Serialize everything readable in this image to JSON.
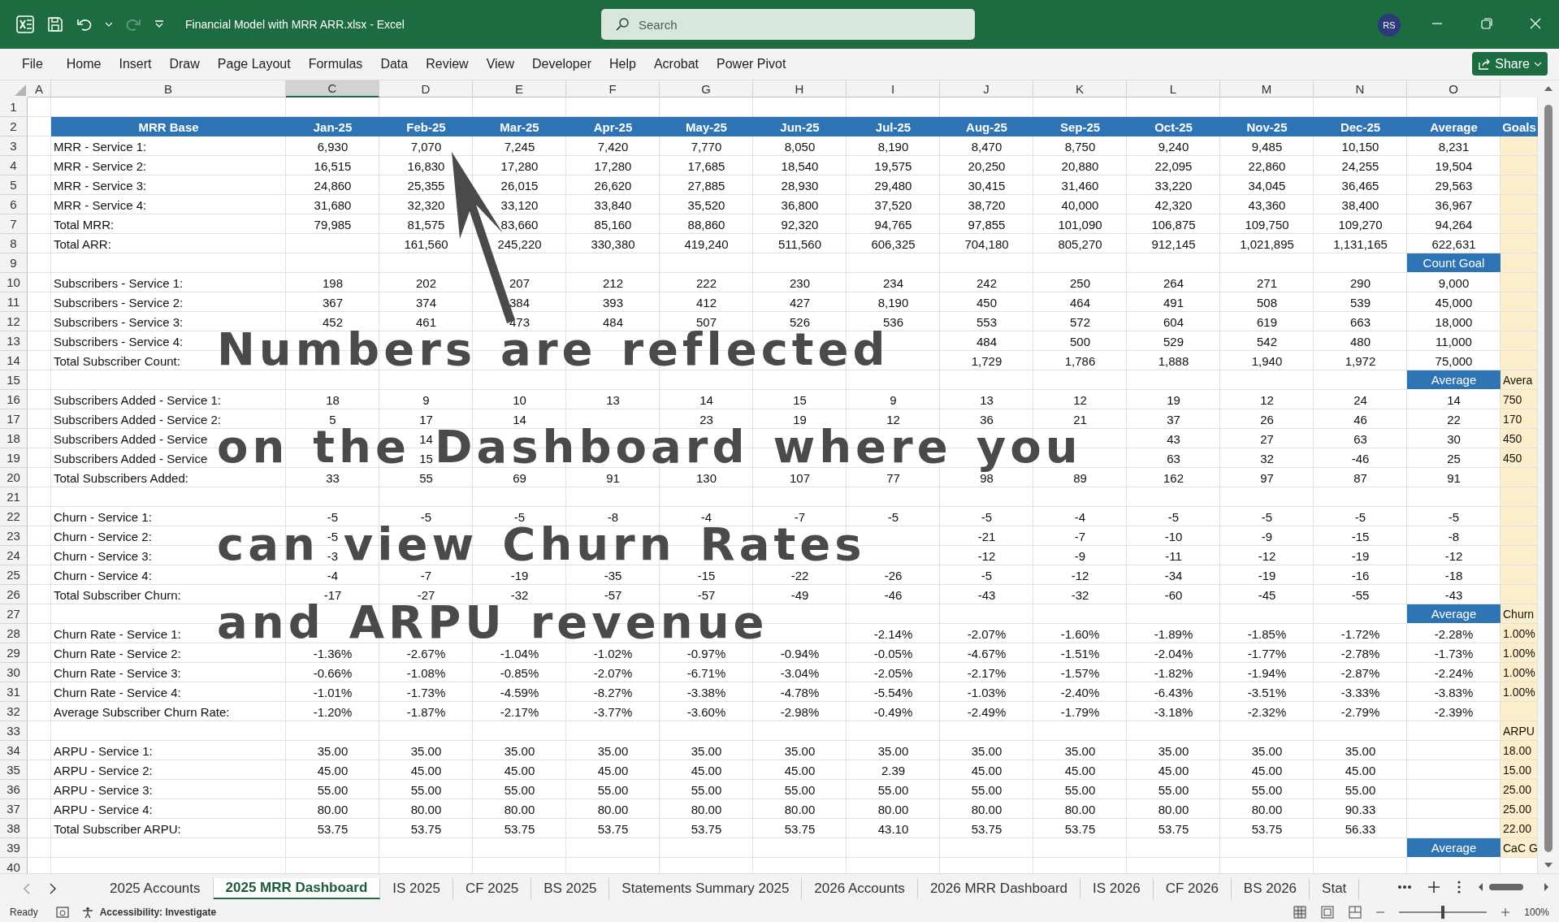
{
  "window": {
    "title": "Financial Model with MRR ARR.xlsx - Excel",
    "redo_disabled": true
  },
  "search": {
    "placeholder": "Search"
  },
  "user": {
    "initials": "RS"
  },
  "menu": [
    {
      "label": "File"
    },
    {
      "label": "Home"
    },
    {
      "label": "Insert"
    },
    {
      "label": "Draw"
    },
    {
      "label": "Page Layout"
    },
    {
      "label": "Formulas"
    },
    {
      "label": "Data"
    },
    {
      "label": "Review"
    },
    {
      "label": "View"
    },
    {
      "label": "Developer"
    },
    {
      "label": "Help"
    },
    {
      "label": "Acrobat"
    },
    {
      "label": "Power Pivot"
    }
  ],
  "share": "Share",
  "columns": [
    {
      "label": "A",
      "selected": false
    },
    {
      "label": "B",
      "selected": false
    },
    {
      "label": "C",
      "selected": true
    },
    {
      "label": "D",
      "selected": false
    },
    {
      "label": "E",
      "selected": false
    },
    {
      "label": "F",
      "selected": false
    },
    {
      "label": "G",
      "selected": false
    },
    {
      "label": "H",
      "selected": false
    },
    {
      "label": "I",
      "selected": false
    },
    {
      "label": "J",
      "selected": false
    },
    {
      "label": "K",
      "selected": false
    },
    {
      "label": "L",
      "selected": false
    },
    {
      "label": "M",
      "selected": false
    },
    {
      "label": "N",
      "selected": false
    },
    {
      "label": "O",
      "selected": false
    }
  ],
  "rows": [
    {
      "n": "1",
      "kind": "data"
    },
    {
      "n": "2",
      "kind": "header",
      "label": "MRR Base",
      "cells": {
        "c": "Jan-25",
        "d": "Feb-25",
        "e": "Mar-25",
        "f": "Apr-25",
        "g": "May-25",
        "h": "Jun-25",
        "i": "Jul-25",
        "j": "Aug-25",
        "k": "Sep-25",
        "l": "Oct-25",
        "m": "Nov-25",
        "n": "Dec-25"
      },
      "avg": "Average",
      "goal": "Goals"
    },
    {
      "n": "3",
      "kind": "data",
      "label": "MRR - Service 1:",
      "cells": {
        "c": "6,930",
        "d": "7,070",
        "e": "7,245",
        "f": "7,420",
        "g": "7,770",
        "h": "8,050",
        "i": "8,190",
        "j": "8,470",
        "k": "8,750",
        "l": "9,240",
        "m": "9,485",
        "n": "10,150"
      },
      "avg": "8,231"
    },
    {
      "n": "4",
      "kind": "data",
      "label": "MRR - Service 2:",
      "cells": {
        "c": "16,515",
        "d": "16,830",
        "e": "17,280",
        "f": "17,280",
        "g": "17,685",
        "h": "18,540",
        "i": "19,575",
        "j": "20,250",
        "k": "20,880",
        "l": "22,095",
        "m": "22,860",
        "n": "24,255"
      },
      "avg": "19,504"
    },
    {
      "n": "5",
      "kind": "data",
      "label": "MRR - Service 3:",
      "cells": {
        "c": "24,860",
        "d": "25,355",
        "e": "26,015",
        "f": "26,620",
        "g": "27,885",
        "h": "28,930",
        "i": "29,480",
        "j": "30,415",
        "k": "31,460",
        "l": "33,220",
        "m": "34,045",
        "n": "36,465"
      },
      "avg": "29,563"
    },
    {
      "n": "6",
      "kind": "data",
      "label": "MRR - Service 4:",
      "cells": {
        "c": "31,680",
        "d": "32,320",
        "e": "33,120",
        "f": "33,840",
        "g": "35,520",
        "h": "36,800",
        "i": "37,520",
        "j": "38,720",
        "k": "40,000",
        "l": "42,320",
        "m": "43,360",
        "n": "38,400"
      },
      "avg": "36,967"
    },
    {
      "n": "7",
      "kind": "data",
      "label": "Total MRR:",
      "cells": {
        "c": "79,985",
        "d": "81,575",
        "e": "83,660",
        "f": "85,160",
        "g": "88,860",
        "h": "92,320",
        "i": "94,765",
        "j": "97,855",
        "k": "101,090",
        "l": "106,875",
        "m": "109,750",
        "n": "109,270"
      },
      "avg": "94,264"
    },
    {
      "n": "8",
      "kind": "data",
      "label": "Total ARR:",
      "cells": {
        "d": "161,560",
        "e": "245,220",
        "f": "330,380",
        "g": "419,240",
        "h": "511,560",
        "i": "606,325",
        "j": "704,180",
        "k": "805,270",
        "l": "912,145",
        "m": "1,021,895",
        "n": "1,131,165"
      },
      "avg": "622,631"
    },
    {
      "n": "9",
      "kind": "section",
      "avg": "Count Goal"
    },
    {
      "n": "10",
      "kind": "data",
      "label": "Subscribers - Service 1:",
      "cells": {
        "c": "198",
        "d": "202",
        "e": "207",
        "f": "212",
        "g": "222",
        "h": "230",
        "i": "234",
        "j": "242",
        "k": "250",
        "l": "264",
        "m": "271",
        "n": "290"
      },
      "avg": "9,000"
    },
    {
      "n": "11",
      "kind": "data",
      "label": "Subscribers - Service 2:",
      "cells": {
        "c": "367",
        "d": "374",
        "e": "384",
        "f": "393",
        "g": "412",
        "h": "427",
        "i": "8,190",
        "j": "450",
        "k": "464",
        "l": "491",
        "m": "508",
        "n": "539"
      },
      "avg": "45,000"
    },
    {
      "n": "12",
      "kind": "data",
      "label": "Subscribers - Service 3:",
      "cells": {
        "c": "452",
        "d": "461",
        "e": "473",
        "f": "484",
        "g": "507",
        "h": "526",
        "i": "536",
        "j": "553",
        "k": "572",
        "l": "604",
        "m": "619",
        "n": "663"
      },
      "avg": "18,000"
    },
    {
      "n": "13",
      "kind": "data",
      "label": "Subscribers - Service 4:",
      "cells": {
        "j": "484",
        "k": "500",
        "l": "529",
        "m": "542",
        "n": "480"
      },
      "avg": "11,000"
    },
    {
      "n": "14",
      "kind": "data",
      "label": "Total Subscriber Count:",
      "cells": {
        "j": "1,729",
        "k": "1,786",
        "l": "1,888",
        "m": "1,940",
        "n": "1,972"
      },
      "avg": "75,000"
    },
    {
      "n": "15",
      "kind": "section",
      "avg": "Average",
      "goal": "Avera"
    },
    {
      "n": "16",
      "kind": "data",
      "label": "Subscribers Added - Service 1:",
      "cells": {
        "c": "18",
        "d": "9",
        "e": "10",
        "f": "13",
        "g": "14",
        "h": "15",
        "i": "9",
        "j": "13",
        "k": "12",
        "l": "19",
        "m": "12",
        "n": "24"
      },
      "avg": "14",
      "goal": "750"
    },
    {
      "n": "17",
      "kind": "data",
      "label": "Subscribers Added - Service 2:",
      "cells": {
        "c": "5",
        "d": "17",
        "e": "14",
        "g": "23",
        "h": "19",
        "i": "12",
        "j": "36",
        "k": "21",
        "l": "37",
        "m": "26",
        "n": "46"
      },
      "avg": "22",
      "goal": "170"
    },
    {
      "n": "18",
      "kind": "data",
      "label": "Subscribers Added - Service",
      "cells": {
        "d": "14",
        "l": "43",
        "m": "27",
        "n": "63"
      },
      "avg": "30",
      "goal": "450"
    },
    {
      "n": "19",
      "kind": "data",
      "label": "Subscribers Added - Service",
      "cells": {
        "d": "15",
        "l": "63",
        "m": "32",
        "n": "-46"
      },
      "avg": "25",
      "goal": "450"
    },
    {
      "n": "20",
      "kind": "data",
      "label": "Total Subscribers Added:",
      "cells": {
        "c": "33",
        "d": "55",
        "e": "69",
        "f": "91",
        "g": "130",
        "h": "107",
        "i": "77",
        "j": "98",
        "k": "89",
        "l": "162",
        "m": "97",
        "n": "87"
      },
      "avg": "91"
    },
    {
      "n": "21",
      "kind": "data"
    },
    {
      "n": "22",
      "kind": "data",
      "label": "Churn - Service 1:",
      "cells": {
        "c": "-5",
        "d": "-5",
        "e": "-5",
        "f": "-8",
        "g": "-4",
        "h": "-7",
        "i": "-5",
        "j": "-5",
        "k": "-4",
        "l": "-5",
        "m": "-5",
        "n": "-5"
      },
      "avg": "-5"
    },
    {
      "n": "23",
      "kind": "data",
      "label": "Churn - Service 2:",
      "cells": {
        "c": "-5",
        "j": "-21",
        "k": "-7",
        "l": "-10",
        "m": "-9",
        "n": "-15"
      },
      "avg": "-8"
    },
    {
      "n": "24",
      "kind": "data",
      "label": "Churn - Service 3:",
      "cells": {
        "c": "-3",
        "j": "-12",
        "k": "-9",
        "l": "-11",
        "m": "-12",
        "n": "-19"
      },
      "avg": "-12"
    },
    {
      "n": "25",
      "kind": "data",
      "label": "Churn - Service 4:",
      "cells": {
        "c": "-4",
        "d": "-7",
        "e": "-19",
        "f": "-35",
        "g": "-15",
        "h": "-22",
        "i": "-26",
        "j": "-5",
        "k": "-12",
        "l": "-34",
        "m": "-19",
        "n": "-16"
      },
      "avg": "-18"
    },
    {
      "n": "26",
      "kind": "data",
      "label": "Total Subscriber Churn:",
      "cells": {
        "c": "-17",
        "d": "-27",
        "e": "-32",
        "f": "-57",
        "g": "-57",
        "h": "-49",
        "i": "-46",
        "j": "-43",
        "k": "-32",
        "l": "-60",
        "m": "-45",
        "n": "-55"
      },
      "avg": "-43"
    },
    {
      "n": "27",
      "kind": "section",
      "avg": "Average",
      "goal": "Churn"
    },
    {
      "n": "28",
      "kind": "data",
      "label": "Churn Rate - Service 1:",
      "cells": {
        "i": "-2.14%",
        "j": "-2.07%",
        "k": "-1.60%",
        "l": "-1.89%",
        "m": "-1.85%",
        "n": "-1.72%"
      },
      "avg": "-2.28%",
      "goal": "1.00%"
    },
    {
      "n": "29",
      "kind": "data",
      "label": "Churn Rate - Service 2:",
      "cells": {
        "c": "-1.36%",
        "d": "-2.67%",
        "e": "-1.04%",
        "f": "-1.02%",
        "g": "-0.97%",
        "h": "-0.94%",
        "i": "-0.05%",
        "j": "-4.67%",
        "k": "-1.51%",
        "l": "-2.04%",
        "m": "-1.77%",
        "n": "-2.78%"
      },
      "avg": "-1.73%",
      "goal": "1.00%"
    },
    {
      "n": "30",
      "kind": "data",
      "label": "Churn Rate - Service 3:",
      "cells": {
        "c": "-0.66%",
        "d": "-1.08%",
        "e": "-0.85%",
        "f": "-2.07%",
        "g": "-6.71%",
        "h": "-3.04%",
        "i": "-2.05%",
        "j": "-2.17%",
        "k": "-1.57%",
        "l": "-1.82%",
        "m": "-1.94%",
        "n": "-2.87%"
      },
      "avg": "-2.24%",
      "goal": "1.00%"
    },
    {
      "n": "31",
      "kind": "data",
      "label": "Churn Rate - Service 4:",
      "cells": {
        "c": "-1.01%",
        "d": "-1.73%",
        "e": "-4.59%",
        "f": "-8.27%",
        "g": "-3.38%",
        "h": "-4.78%",
        "i": "-5.54%",
        "j": "-1.03%",
        "k": "-2.40%",
        "l": "-6.43%",
        "m": "-3.51%",
        "n": "-3.33%"
      },
      "avg": "-3.83%",
      "goal": "1.00%"
    },
    {
      "n": "32",
      "kind": "data",
      "label": "Average Subscriber Churn Rate:",
      "cells": {
        "c": "-1.20%",
        "d": "-1.87%",
        "e": "-2.17%",
        "f": "-3.77%",
        "g": "-3.60%",
        "h": "-2.98%",
        "i": "-0.49%",
        "j": "-2.49%",
        "k": "-1.79%",
        "l": "-3.18%",
        "m": "-2.32%",
        "n": "-2.79%"
      },
      "avg": "-2.39%"
    },
    {
      "n": "33",
      "kind": "data",
      "goal": "ARPU"
    },
    {
      "n": "34",
      "kind": "data",
      "label": "ARPU - Service 1:",
      "cells": {
        "c": "35.00",
        "d": "35.00",
        "e": "35.00",
        "f": "35.00",
        "g": "35.00",
        "h": "35.00",
        "i": "35.00",
        "j": "35.00",
        "k": "35.00",
        "l": "35.00",
        "m": "35.00",
        "n": "35.00"
      },
      "goal": "18.00"
    },
    {
      "n": "35",
      "kind": "data",
      "label": "ARPU - Service 2:",
      "cells": {
        "c": "45.00",
        "d": "45.00",
        "e": "45.00",
        "f": "45.00",
        "g": "45.00",
        "h": "45.00",
        "i": "2.39",
        "j": "45.00",
        "k": "45.00",
        "l": "45.00",
        "m": "45.00",
        "n": "45.00"
      },
      "goal": "15.00"
    },
    {
      "n": "36",
      "kind": "data",
      "label": "ARPU - Service 3:",
      "cells": {
        "c": "55.00",
        "d": "55.00",
        "e": "55.00",
        "f": "55.00",
        "g": "55.00",
        "h": "55.00",
        "i": "55.00",
        "j": "55.00",
        "k": "55.00",
        "l": "55.00",
        "m": "55.00",
        "n": "55.00"
      },
      "goal": "25.00"
    },
    {
      "n": "37",
      "kind": "data",
      "label": "ARPU - Service 4:",
      "cells": {
        "c": "80.00",
        "d": "80.00",
        "e": "80.00",
        "f": "80.00",
        "g": "80.00",
        "h": "80.00",
        "i": "80.00",
        "j": "80.00",
        "k": "80.00",
        "l": "80.00",
        "m": "80.00",
        "n": "90.33"
      },
      "goal": "25.00"
    },
    {
      "n": "38",
      "kind": "data",
      "label": "Total Subscriber ARPU:",
      "cells": {
        "c": "53.75",
        "d": "53.75",
        "e": "53.75",
        "f": "53.75",
        "g": "53.75",
        "h": "53.75",
        "i": "43.10",
        "j": "53.75",
        "k": "53.75",
        "l": "53.75",
        "m": "53.75",
        "n": "56.33"
      },
      "goal": "22.00"
    },
    {
      "n": "39",
      "kind": "section",
      "avg": "Average",
      "goal": "CaC G"
    },
    {
      "n": "40",
      "kind": "data"
    }
  ],
  "annotation": {
    "lines": [
      "Numbers are reflected",
      "on the Dashboard where you",
      "can view Churn Rates",
      "and ARPU revenue"
    ]
  },
  "sheet_tabs": [
    {
      "label": "2025 Accounts",
      "selected": false
    },
    {
      "label": "2025 MRR Dashboard",
      "selected": true
    },
    {
      "label": "IS 2025",
      "selected": false
    },
    {
      "label": "CF 2025",
      "selected": false
    },
    {
      "label": "BS 2025",
      "selected": false
    },
    {
      "label": "Statements Summary 2025",
      "selected": false
    },
    {
      "label": "2026 Accounts",
      "selected": false
    },
    {
      "label": "2026 MRR Dashboard",
      "selected": false
    },
    {
      "label": "IS 2026",
      "selected": false
    },
    {
      "label": "CF 2026",
      "selected": false
    },
    {
      "label": "BS 2026",
      "selected": false
    },
    {
      "label": "Stat",
      "selected": false
    }
  ],
  "status": {
    "ready": "Ready",
    "accessibility": "Accessibility: Investigate",
    "zoom": "100%"
  },
  "zoom_slider": {
    "level": 0.5
  }
}
